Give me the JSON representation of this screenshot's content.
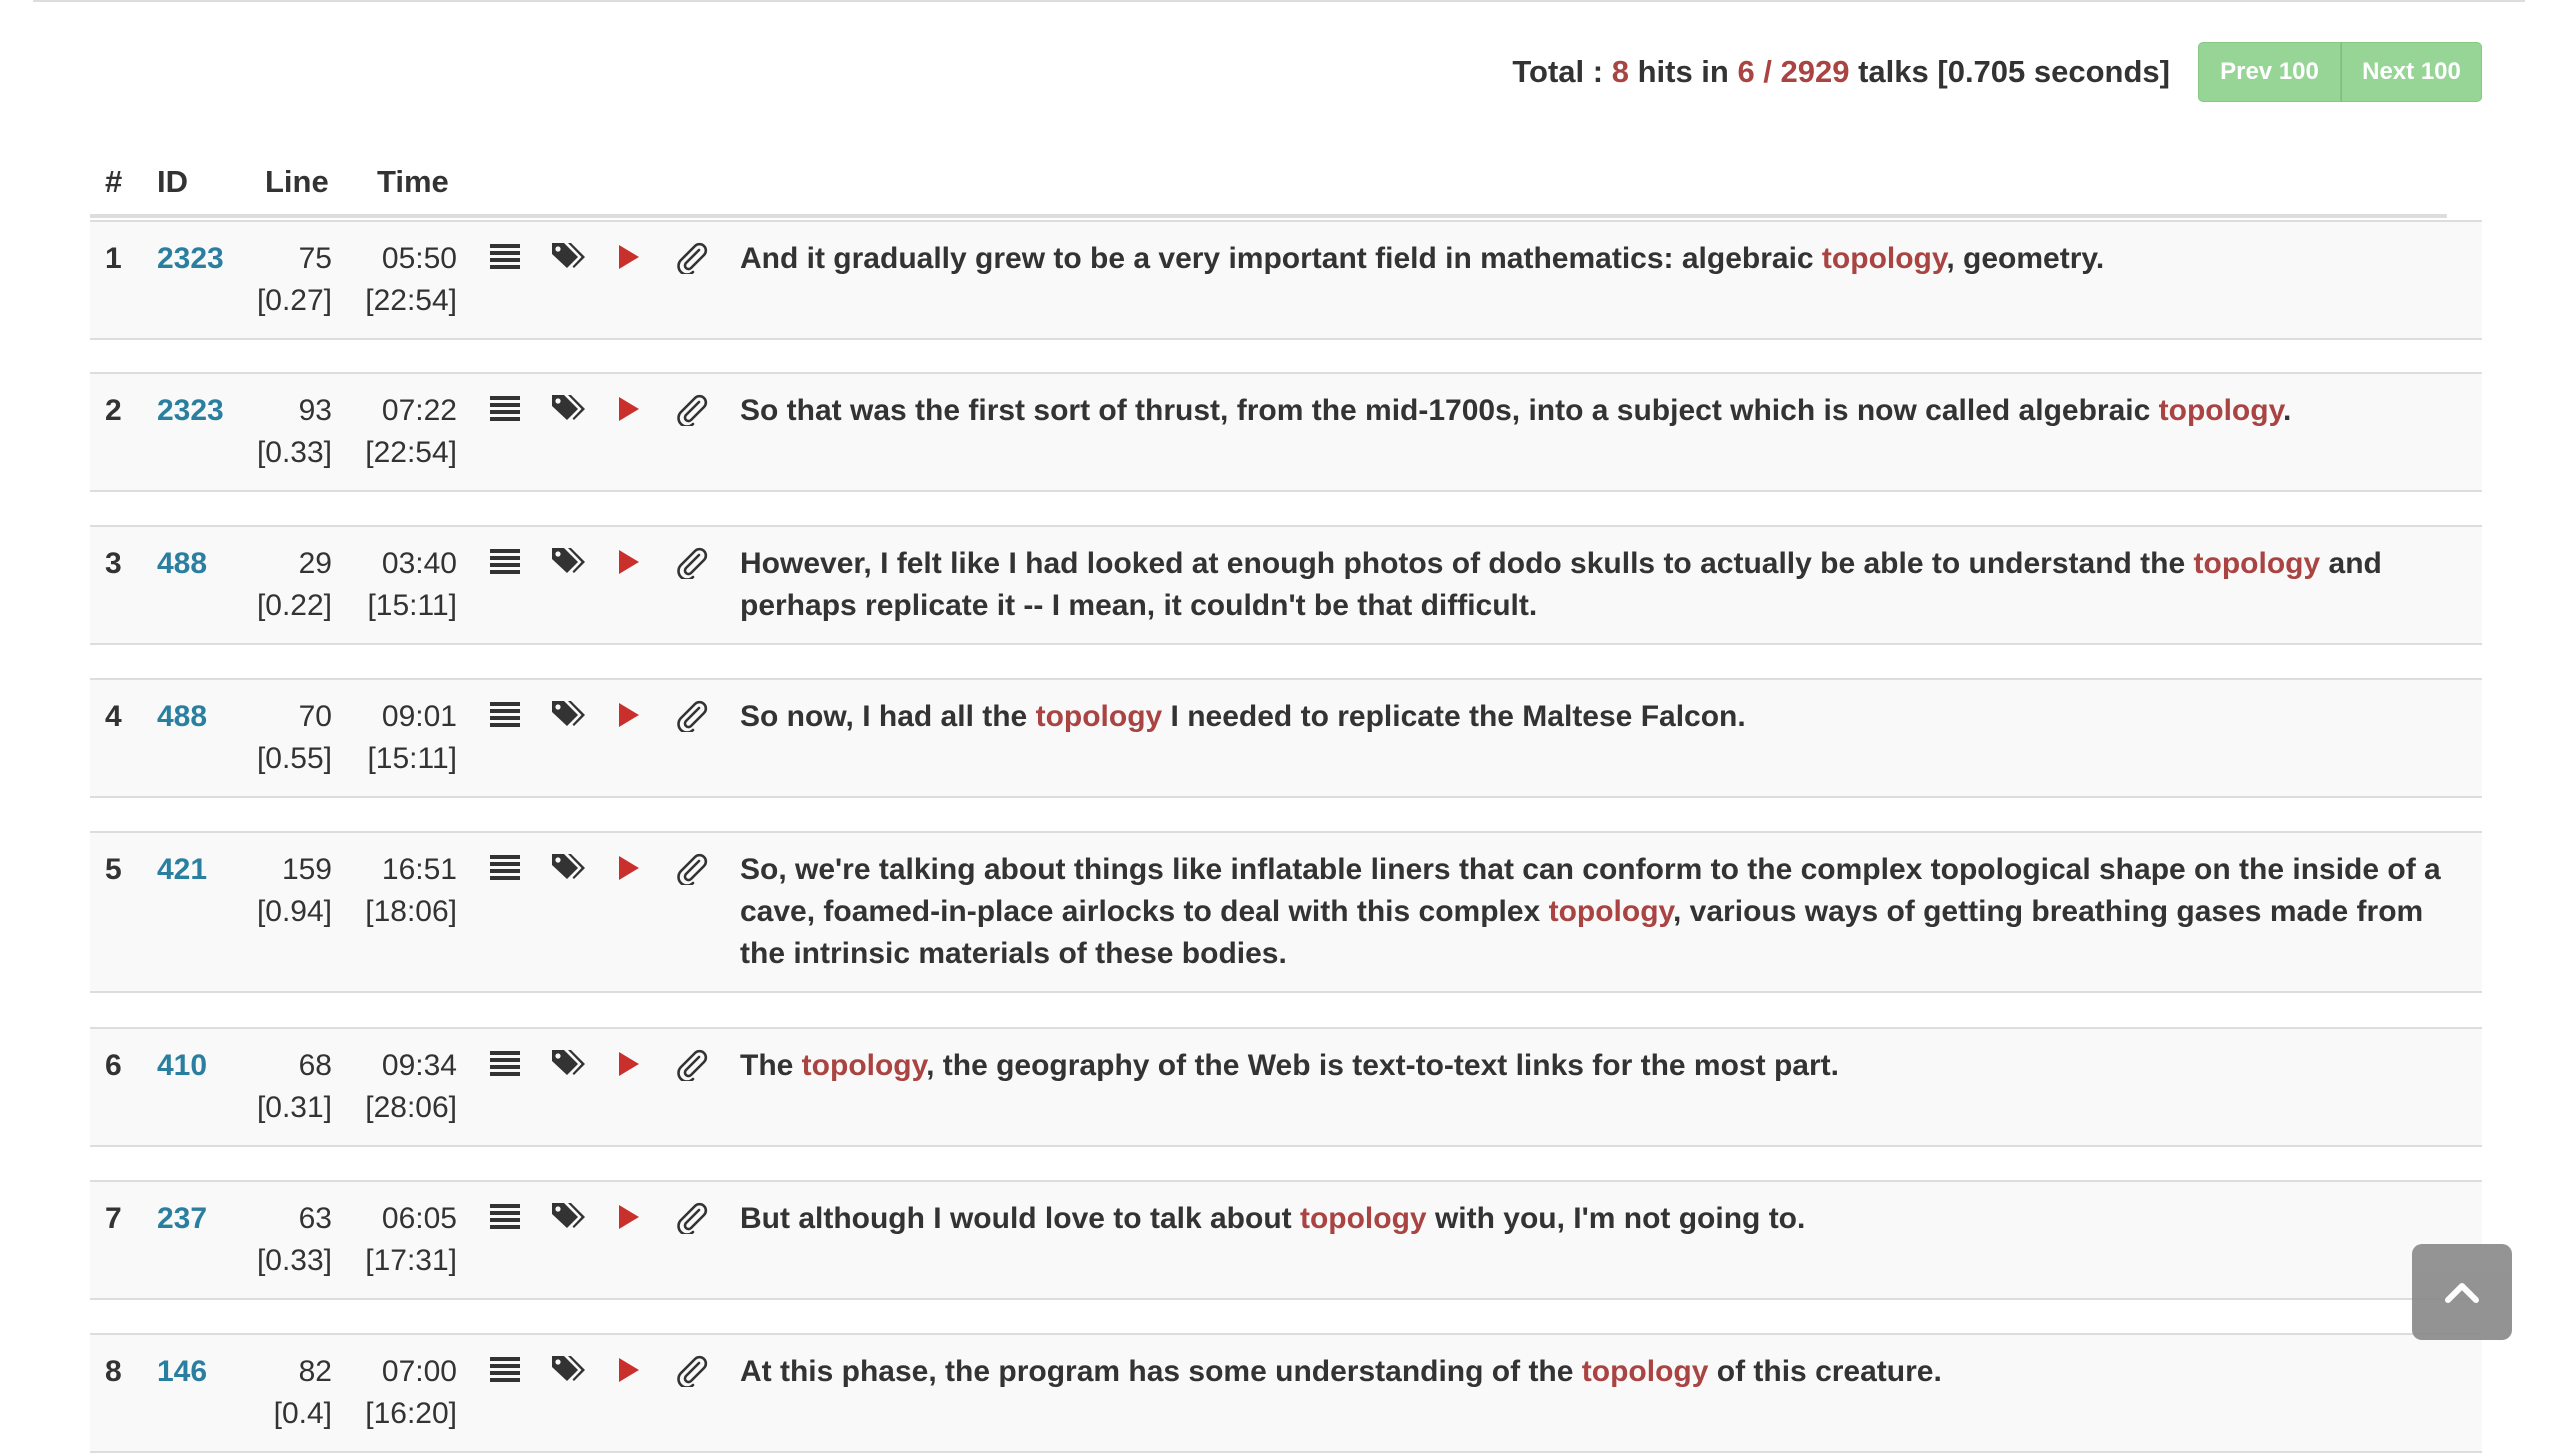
{
  "summary": {
    "total_label": "Total : ",
    "hits": "8",
    "hits_label": " hits in ",
    "talks_fraction": "6 / 2929",
    "talks_label": " talks [0.705 seconds]",
    "prev_button": "Prev 100",
    "next_button": "Next 100"
  },
  "columns": {
    "num": "#",
    "id": "ID",
    "line": "Line",
    "time": "Time"
  },
  "colors": {
    "highlight": "#a94442",
    "id_link": "#2a7fa0",
    "button": "#96d596"
  },
  "icons": [
    "list-icon",
    "tags-icon",
    "play-icon",
    "paperclip-icon",
    "chevron-up-icon"
  ],
  "rows": [
    {
      "num": "1",
      "id": "2323",
      "line": "75",
      "line_sub": "[0.27]",
      "time": "05:50",
      "time_sub": "[22:54]",
      "before": "And it gradually grew to be a very important field in mathematics: algebraic ",
      "term": "topology",
      "after": ", geometry."
    },
    {
      "num": "2",
      "id": "2323",
      "line": "93",
      "line_sub": "[0.33]",
      "time": "07:22",
      "time_sub": "[22:54]",
      "before": "So that was the first sort of thrust, from the mid-1700s, into a subject which is now called algebraic ",
      "term": "topology",
      "after": "."
    },
    {
      "num": "3",
      "id": "488",
      "line": "29",
      "line_sub": "[0.22]",
      "time": "03:40",
      "time_sub": "[15:11]",
      "before": "However, I felt like I had looked at enough photos of dodo skulls to actually be able to understand the ",
      "term": "topology",
      "after": " and perhaps replicate it -- I mean, it couldn't be that difficult."
    },
    {
      "num": "4",
      "id": "488",
      "line": "70",
      "line_sub": "[0.55]",
      "time": "09:01",
      "time_sub": "[15:11]",
      "before": "So now, I had all the ",
      "term": "topology",
      "after": " I needed to replicate the Maltese Falcon."
    },
    {
      "num": "5",
      "id": "421",
      "line": "159",
      "line_sub": "[0.94]",
      "time": "16:51",
      "time_sub": "[18:06]",
      "before": "So, we're talking about things like inflatable liners that can conform to the complex topological shape on the inside of a cave, foamed-in-place airlocks to deal with this complex ",
      "term": "topology",
      "after": ", various ways of getting breathing gases made from the intrinsic materials of these bodies."
    },
    {
      "num": "6",
      "id": "410",
      "line": "68",
      "line_sub": "[0.31]",
      "time": "09:34",
      "time_sub": "[28:06]",
      "before": "The ",
      "term": "topology",
      "after": ", the geography of the Web is text-to-text links for the most part."
    },
    {
      "num": "7",
      "id": "237",
      "line": "63",
      "line_sub": "[0.33]",
      "time": "06:05",
      "time_sub": "[17:31]",
      "before": "But although I would love to talk about ",
      "term": "topology",
      "after": " with you, I'm not going to."
    },
    {
      "num": "8",
      "id": "146",
      "line": "82",
      "line_sub": "[0.4]",
      "time": "07:00",
      "time_sub": "[16:20]",
      "before": "At this phase, the program has some understanding of the ",
      "term": "topology",
      "after": " of this creature."
    }
  ]
}
